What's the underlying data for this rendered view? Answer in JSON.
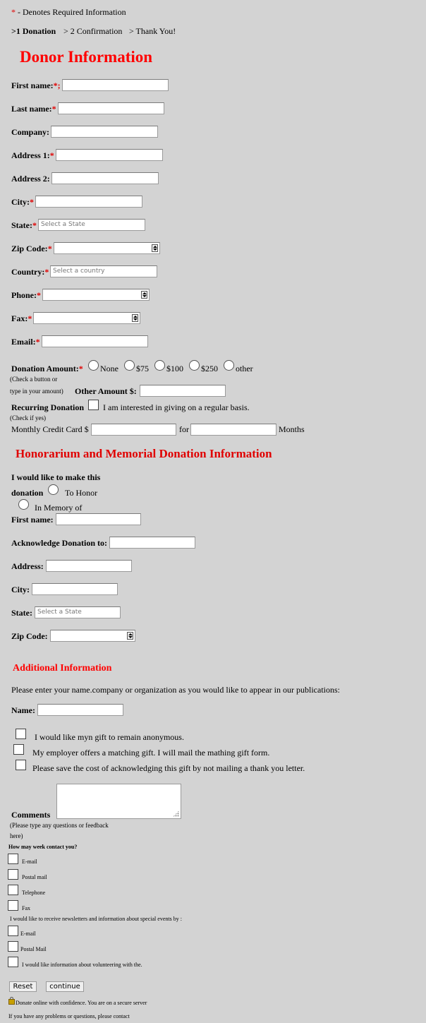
{
  "legend": {
    "star": "*",
    "text": " - Denotes Required Information"
  },
  "steps": {
    "step1": ">1 Donation",
    "step2": "> 2 Confirmation",
    "step3": "> Thank You!"
  },
  "donor": {
    "heading": "Donor Information",
    "first_name": "First name:",
    "first_name_star": "*;",
    "last_name": "Last name:",
    "company": "Company:",
    "address1": "Address 1:",
    "address2": "Address 2:",
    "city": "City:",
    "state": "State:",
    "state_placeholder": "Select a State",
    "zip": "Zip Code:",
    "country": "Country:",
    "country_placeholder": "Select a country",
    "phone": "Phone:",
    "fax": "Fax:",
    "email": "Email:",
    "star": "*"
  },
  "amount": {
    "label": "Donation Amount:",
    "hint1": "(Check a button or",
    "hint2": "type in your amount)",
    "options": [
      "None",
      "$75",
      "$100",
      "$250",
      "other"
    ],
    "other_label": "Other Amount $:",
    "recurring_label": "Recurring Donation",
    "recurring_text": "I am interested in giving on a regular basis.",
    "recurring_hint": "(Check if yes)",
    "monthly_label": "Monthly Credit Card $",
    "for": "for",
    "months": "Months"
  },
  "honor": {
    "heading": "Honorarium and Memorial Donation Information",
    "intro1": "I would like to make this",
    "intro2": "donation",
    "to_honor": "To Honor",
    "in_memory": "In Memory of",
    "first_name": "First name:",
    "acknowledge": "Acknowledge Donation to:",
    "address": "Address:",
    "city": "City:",
    "state": "State:",
    "state_placeholder": "Select a State",
    "zip": "Zip Code:"
  },
  "additional": {
    "heading": "Additional Information",
    "intro": "Please enter your name.company or organization as you would like to appear in our publications:",
    "name": "Name:",
    "anonymous": "I would like myn gift to remain anonymous.",
    "employer": "My employer offers a matching gift. I will mail the mathing gift form.",
    "no_thanks": "Please save the cost of acknowledging this gift by not mailing a thank you letter.",
    "comments": "Comments",
    "comments_hint1": "(Please type any questions or feedback",
    "comments_hint2": "here)",
    "contact_q": "How may week contact you?",
    "contact_options": [
      "E-mail",
      "Postal mail",
      "Telephone",
      "Fax"
    ],
    "newsletter_q": "I would like to receive newsletters and information about special events by :",
    "newsletter_options": [
      "E-mail",
      "Postal Mail"
    ],
    "volunteer": "I would like information about volunteering with the."
  },
  "buttons": {
    "reset": "Reset",
    "continue": "continue"
  },
  "footer": {
    "secure": "Donate online with confidence. You are on a secure server",
    "problems": "If you have any problems or questions, please contact"
  }
}
